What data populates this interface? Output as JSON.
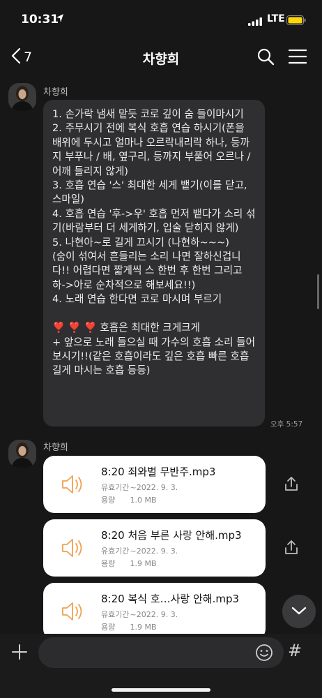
{
  "status_bar": {
    "time": "10:31",
    "network": "LTE"
  },
  "header": {
    "back_count": "7",
    "title": "차향희"
  },
  "messages": [
    {
      "sender": "차향희",
      "text": "1. 손가락 냄새 맡듯 코로 깊이 숨 들이마시기\n2. 주무시기 전에 복식 호흡 연습 하시기(폰을 배위에 두시고 얼마나 오르락내리락 하나, 등까지 부푸나 / 배, 옆구리, 등까지 부풀어 오르나 / 어깨 들리지 않게)\n3. 호흡 연습 '스' 최대한 세게 뱉기(이를 닫고, 스마일)\n4. 호흡 연습 '후->우' 호흡 먼저 뱉다가 소리 섞기(바람부터 더 세게하기, 입술 닫히지 않게)\n5. 나현아~로 길게 끄시기 (나현하~~~)\n(숨이 섞여서 흔들리는 소리 나면 잘하신겁니다!! 어렵다면 짧게씩 스 한번 후 한번 그리고 하->아로 순차적으로 해보세요!!)\n4. 노래 연습 한다면 코로 마시며 부르기\n\n❣️ ❣️ ❣️ 호흡은 최대한 크게크게\n+ 앞으로 노래 들으실 때 가수의 호흡 소리 들어보시기!!(같은 호흡이라도 깊은 호흡 빠른 호흡 길게 마시는 호흡 등등)",
      "time": "오후 5:57"
    }
  ],
  "file_group": {
    "sender": "차향희",
    "validity_label": "유효기간",
    "size_label": "용량",
    "files": [
      {
        "name": "8:20 죄와벌 무반주.mp3",
        "expiry": "~2022. 9. 3.",
        "size": "1.0 MB"
      },
      {
        "name": "8:20 처음 부른 사랑 안해.mp3",
        "expiry": "~2022. 9. 3.",
        "size": "1.9 MB"
      },
      {
        "name": "8:20 복식 호…사랑 안해.mp3",
        "expiry": "~2022. 9. 3.",
        "size": "1.9 MB"
      }
    ]
  },
  "input": {
    "value": "",
    "hash_symbol": "#"
  },
  "colors": {
    "background": "#171717",
    "bubble": "#2f2f31",
    "file_card": "#ffffff",
    "audio_icon": "#f0a04b",
    "battery": "#ffd60a"
  },
  "icons": [
    "location-arrow-icon",
    "signal-icon",
    "battery-icon",
    "chevron-left-icon",
    "search-icon",
    "menu-icon",
    "audio-speaker-icon",
    "share-icon",
    "chevron-down-icon",
    "plus-icon",
    "emoji-icon"
  ]
}
